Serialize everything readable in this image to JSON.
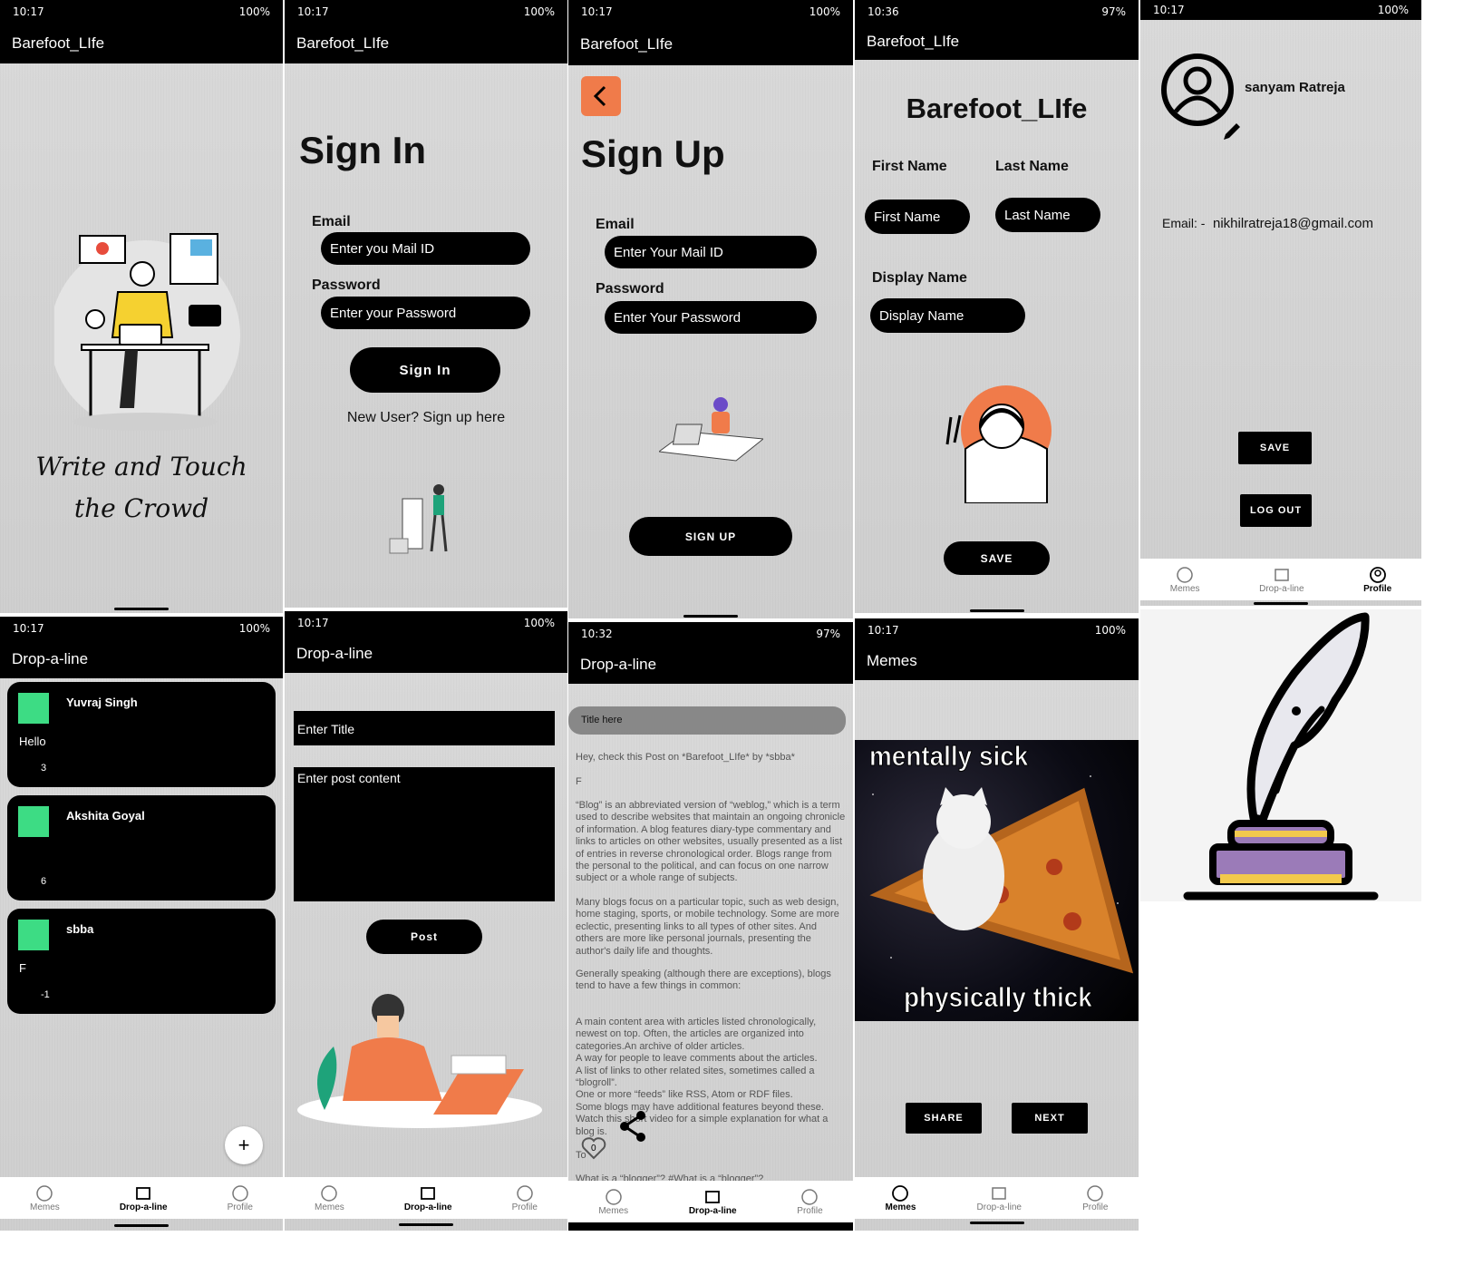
{
  "status_times": [
    "10:17",
    "10:17",
    "10:17",
    "10:36",
    "10:17",
    "10:17",
    "10:17",
    "10:32",
    "10:17"
  ],
  "battery": {
    "full": "100%",
    "p97": "97%"
  },
  "app_title": "Barefoot_LIfe",
  "s1": {
    "tagline1": "Write and Touch",
    "tagline2": "the Crowd"
  },
  "s2": {
    "heading": "Sign In",
    "email_label": "Email",
    "email_ph": "Enter you Mail ID",
    "password_label": "Password",
    "password_ph": "Enter your Password",
    "button": "Sign In",
    "link": "New User? Sign up here"
  },
  "s3": {
    "heading": "Sign Up",
    "email_label": "Email",
    "email_ph": "Enter Your Mail ID",
    "password_label": "Password",
    "password_ph": "Enter Your Password",
    "button": "SIGN UP"
  },
  "s4": {
    "heading": "Barefoot_LIfe",
    "first_label": "First Name",
    "last_label": "Last Name",
    "first_ph": "First Name",
    "last_ph": "Last Name",
    "display_label": "Display Name",
    "display_ph": "Display Name",
    "button": "SAVE"
  },
  "s5": {
    "name": "sanyam Ratreja",
    "email_label": "Email: -",
    "email": "nikhilratreja18@gmail.com",
    "save": "SAVE",
    "logout": "LOG OUT"
  },
  "nav": {
    "memes": "Memes",
    "drop": "Drop-a-line",
    "profile": "Profile"
  },
  "drop_title": "Drop-a-line",
  "memes_title": "Memes",
  "posts": [
    {
      "author": "Yuvraj Singh",
      "body": "Hello",
      "count": "3"
    },
    {
      "author": "Akshita Goyal",
      "body": "",
      "count": "6"
    },
    {
      "author": "sbba",
      "body": "F",
      "count": "-1"
    }
  ],
  "fab": "+",
  "s7": {
    "title_ph": "Enter Title",
    "content_ph": "Enter post content",
    "button": "Post"
  },
  "s8": {
    "title": "Title here",
    "intro": "Hey, check this Post on *Barefoot_LIfe* by *sbba*",
    "f": "F",
    "p1": "“Blog” is an abbreviated version of “weblog,” which is a term used to describe websites that maintain an ongoing chronicle of information. A blog features diary-type commentary and links to articles on other websites, usually presented as a list of entries in reverse chronological order. Blogs range from the personal to the political, and can focus on one narrow subject or a whole range of subjects.",
    "p2": "Many blogs focus on a particular topic, such as web design, home staging, sports, or mobile technology. Some are more eclectic, presenting links to all types of other sites. And others are more like personal journals, presenting the author's daily life and thoughts.",
    "p3": "Generally speaking (although there are exceptions), blogs tend to have a few things in common:",
    "p4": "A main content area with articles listed chronologically, newest on top. Often, the articles are organized into categories.An archive of older articles.\nA way for people to leave comments about the articles.\nA list of links to other related sites, sometimes called a “blogroll”.\nOne or more “feeds” like RSS, Atom or RDF files.\nSome blogs may have additional features beyond these. Watch this short video for a simple explanation for what a blog is.",
    "p5": "To",
    "p6": "What is a “blogger”? #What is a “blogger”?",
    "like_count": "0"
  },
  "meme": {
    "top": "mentally sick",
    "bottom": "physically thick",
    "share": "SHARE",
    "next": "NEXT"
  }
}
